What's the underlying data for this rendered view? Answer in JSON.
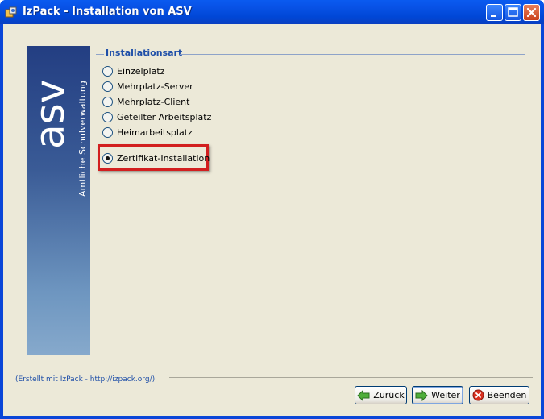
{
  "window": {
    "title": "IzPack - Installation von ASV",
    "controls": [
      "minimize",
      "maximize",
      "close"
    ]
  },
  "banner": {
    "logo_text": "asv",
    "subtitle": "Amtliche Schulverwaltung"
  },
  "installation_type": {
    "group_label": "Installationsart",
    "options": [
      {
        "label": "Einzelplatz",
        "checked": false
      },
      {
        "label": "Mehrplatz-Server",
        "checked": false
      },
      {
        "label": "Mehrplatz-Client",
        "checked": false
      },
      {
        "label": "Geteilter Arbeitsplatz",
        "checked": false
      },
      {
        "label": "Heimarbeitsplatz",
        "checked": false
      },
      {
        "label": "Zertifikat-Installation",
        "checked": true
      }
    ]
  },
  "footer": {
    "credit": "(Erstellt mit IzPack - http://izpack.org/)",
    "back_label": "Zurück",
    "next_label": "Weiter",
    "quit_label": "Beenden"
  },
  "colors": {
    "title_bar": "#0a46d8",
    "client_bg": "#ece9d8",
    "banner_top": "#233e82",
    "banner_bottom": "#86a9cc",
    "highlight": "#d21f1f",
    "group_label": "#1f4fa8"
  },
  "icons": {
    "app": "izpack-app-icon",
    "back": "green-arrow-left-icon",
    "next": "green-arrow-right-icon",
    "quit": "red-x-circle-icon"
  }
}
